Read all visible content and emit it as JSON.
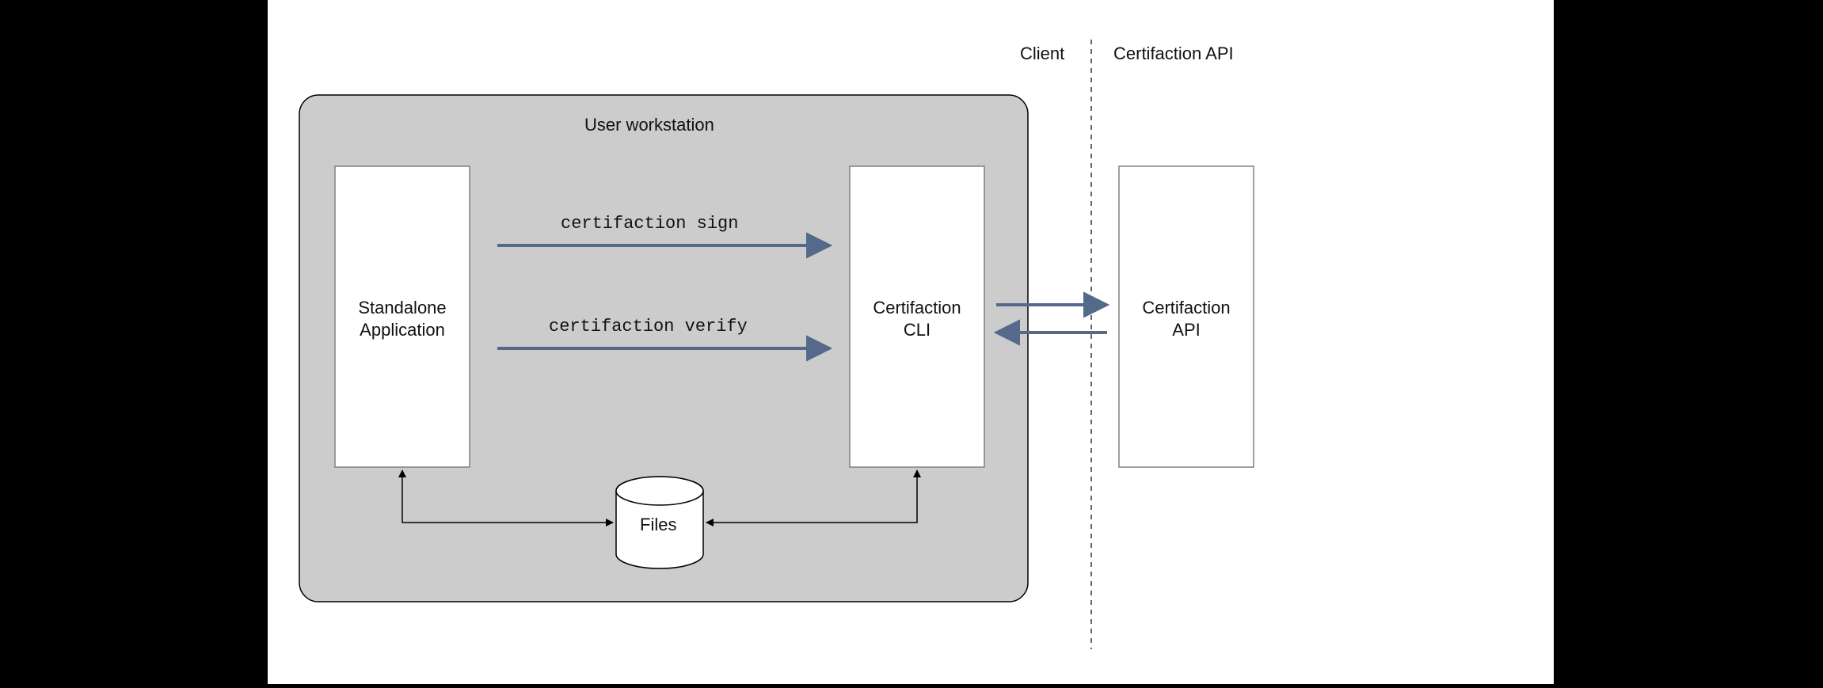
{
  "header": {
    "client": "Client",
    "api": "Certifaction API"
  },
  "workstation": {
    "title": "User workstation",
    "standalone": "Standalone Application",
    "cli": "Certifaction CLI",
    "files": "Files",
    "cmd_sign": "certifaction sign",
    "cmd_verify": "certifaction verify"
  },
  "api_box": "Certifaction API",
  "colors": {
    "arrow": "#556a8a",
    "workstation_fill": "#cccccc",
    "box_stroke": "#808080"
  }
}
